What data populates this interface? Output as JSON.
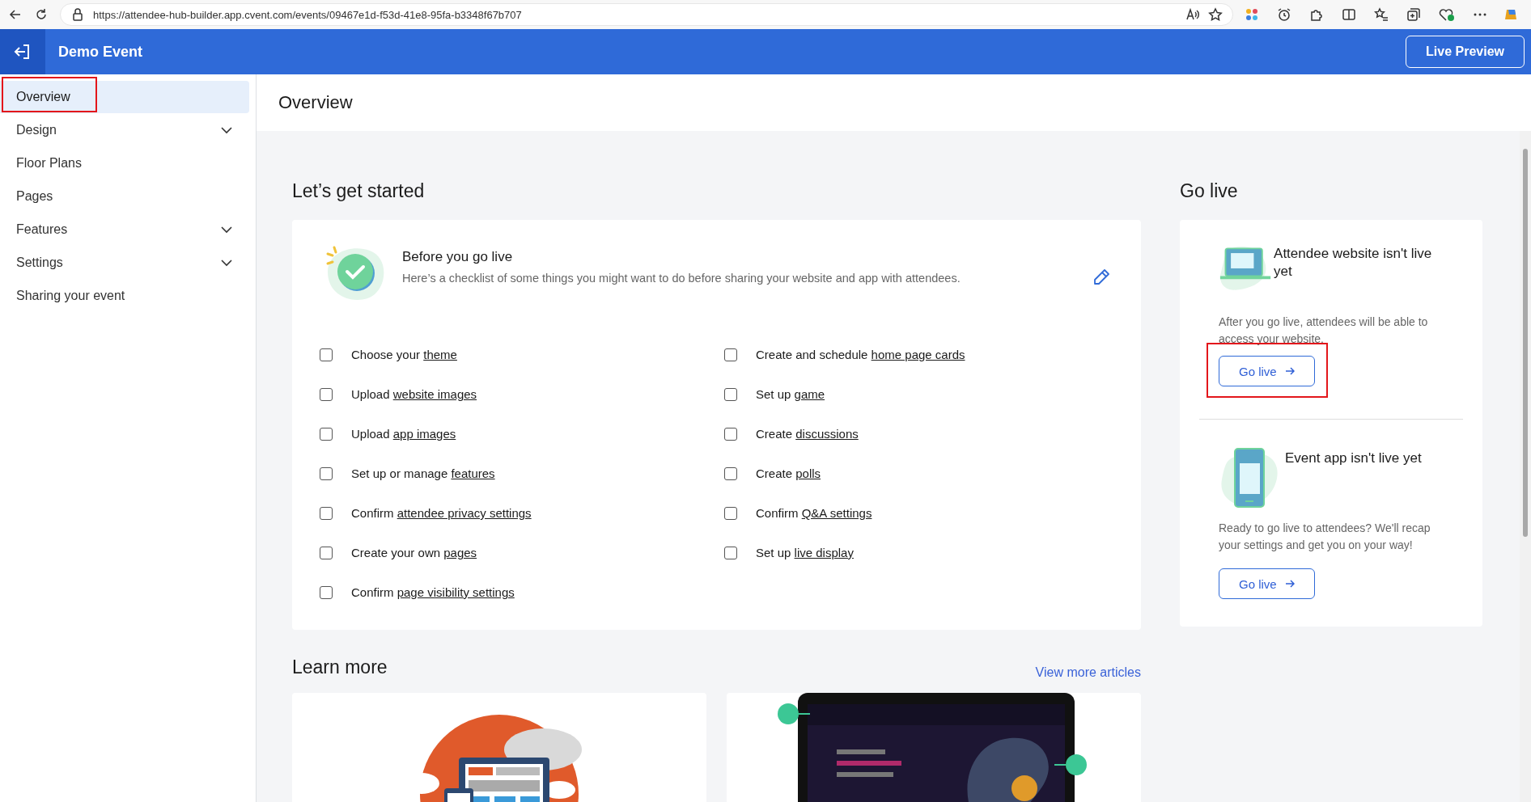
{
  "browser": {
    "url": "https://attendee-hub-builder.app.cvent.com/events/09467e1d-f53d-41e8-95fa-b3348f67b707"
  },
  "header": {
    "title": "Demo Event",
    "preview_button": "Live Preview"
  },
  "sidebar": {
    "items": [
      {
        "label": "Overview",
        "selected": true,
        "expandable": false,
        "annotated": true
      },
      {
        "label": "Design",
        "selected": false,
        "expandable": true,
        "expanded": false,
        "annotated": false
      },
      {
        "label": "Floor Plans",
        "selected": false,
        "expandable": false,
        "annotated": false
      },
      {
        "label": "Pages",
        "selected": false,
        "expandable": false,
        "annotated": false
      },
      {
        "label": "Features",
        "selected": false,
        "expandable": true,
        "expanded": false,
        "annotated": false
      },
      {
        "label": "Settings",
        "selected": false,
        "expandable": true,
        "expanded": false,
        "annotated": false
      },
      {
        "label": "Sharing your event",
        "selected": false,
        "expandable": false,
        "annotated": false
      }
    ]
  },
  "page_title": "Overview",
  "getting_started": {
    "heading": "Let’s get started",
    "checklist_card": {
      "title": "Before you go live",
      "subtitle": "Here’s a checklist of some things you might want to do before sharing your website and app with attendees.",
      "items": [
        {
          "text": "Choose your ",
          "link": "theme",
          "checked": false
        },
        {
          "text": "Create and schedule ",
          "link": "home page cards",
          "checked": false
        },
        {
          "text": "Upload ",
          "link": "website images",
          "checked": false
        },
        {
          "text": "Set up ",
          "link": "game",
          "checked": false
        },
        {
          "text": "Upload ",
          "link": "app images",
          "checked": false
        },
        {
          "text": "Create ",
          "link": "discussions",
          "checked": false
        },
        {
          "text": "Set up or manage ",
          "link": "features",
          "checked": false
        },
        {
          "text": "Create ",
          "link": "polls",
          "checked": false
        },
        {
          "text": "Confirm ",
          "link": "attendee privacy settings",
          "checked": false
        },
        {
          "text": "Confirm ",
          "link": "Q&A settings",
          "checked": false
        },
        {
          "text": "Create your own ",
          "link": "pages",
          "checked": false
        },
        {
          "text": "Set up ",
          "link": "live display",
          "checked": false
        },
        {
          "text": "Confirm ",
          "link": "page visibility settings",
          "checked": false
        }
      ]
    }
  },
  "go_live": {
    "heading": "Go live",
    "sections": [
      {
        "kind": "website",
        "title": "Attendee website isn't live yet",
        "text": "After you go live, attendees will be able to access your website.",
        "button": "Go live",
        "annotated": true
      },
      {
        "kind": "app",
        "title": "Event app isn't live yet",
        "text": "Ready to go live to attendees? We'll recap your settings and get you on your way!",
        "button": "Go live",
        "annotated": false
      }
    ]
  },
  "learn_more": {
    "heading": "Learn more",
    "link": "View more articles"
  }
}
